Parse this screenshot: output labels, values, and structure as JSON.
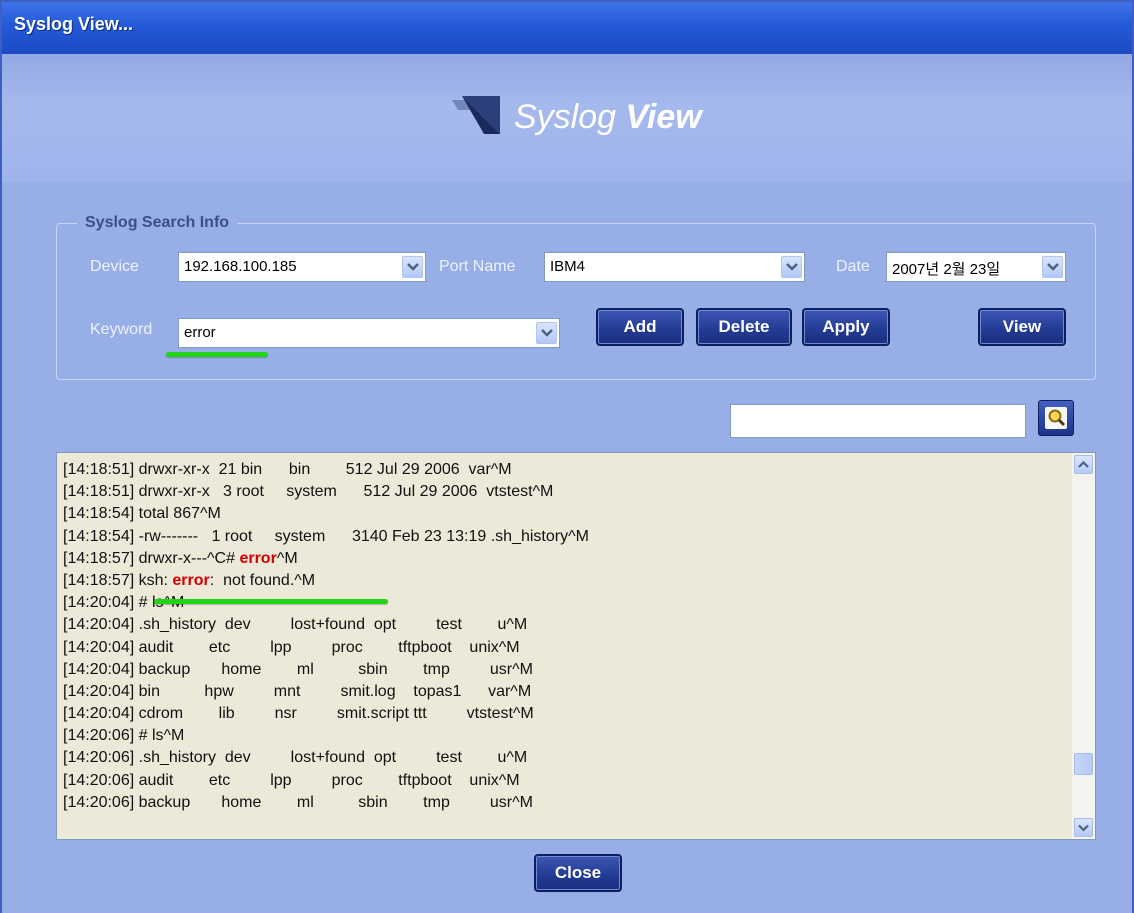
{
  "window": {
    "title": "Syslog View..."
  },
  "banner": {
    "title_light": "Syslog ",
    "title_bold": "View"
  },
  "search_info": {
    "legend": "Syslog Search Info",
    "device_label": "Device",
    "device_value": "192.168.100.185",
    "port_label": "Port Name",
    "port_value": "IBM4",
    "date_label": "Date",
    "date_value": "2007년  2월 23일",
    "keyword_label": "Keyword",
    "keyword_value": "error",
    "buttons": {
      "add": "Add",
      "delete": "Delete",
      "apply": "Apply",
      "view": "View"
    }
  },
  "find": {
    "value": ""
  },
  "log": {
    "lines": [
      "[14:18:51] drwxr-xr-x  21 bin      bin        512 Jul 29 2006  var^M",
      "[14:18:51] drwxr-xr-x   3 root     system      512 Jul 29 2006  vtstest^M",
      "[14:18:54] total 867^M",
      "[14:18:54] -rw-------   1 root     system      3140 Feb 23 13:19 .sh_history^M",
      {
        "pre": "[14:18:57] drwxr-x---^C# ",
        "kw": "error",
        "post": "^M"
      },
      {
        "pre": "[14:18:57] ksh: ",
        "kw": "error",
        "post": ":  not found.^M"
      },
      "[14:20:04] # ls^M",
      "[14:20:04] .sh_history  dev         lost+found  opt         test        u^M",
      "[14:20:04] audit        etc         lpp         proc        tftpboot    unix^M",
      "[14:20:04] backup       home        ml          sbin        tmp         usr^M",
      "[14:20:04] bin          hpw         mnt         smit.log    topas1      var^M",
      "[14:20:04] cdrom        lib         nsr         smit.script ttt         vtstest^M",
      "[14:20:06] # ls^M",
      "[14:20:06] .sh_history  dev         lost+found  opt         test        u^M",
      "[14:20:06] audit        etc         lpp         proc        tftpboot    unix^M",
      "[14:20:06] backup       home        ml          sbin        tmp         usr^M"
    ]
  },
  "footer": {
    "close": "Close"
  },
  "colors": {
    "highlight": "#22d316",
    "keyword": "#d40000",
    "button": "#223a92"
  }
}
